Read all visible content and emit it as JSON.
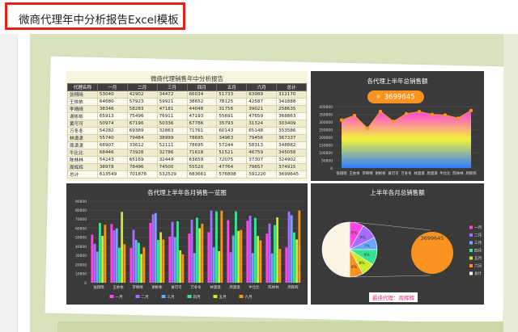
{
  "page": {
    "title": "微商代理年中分析报告Excel模板"
  },
  "table": {
    "title": "微商代理销售年中分析报告",
    "columns": [
      "代理名称",
      "一月",
      "二月",
      "三月",
      "四月",
      "五月",
      "六月",
      "总计"
    ],
    "rows": [
      [
        "张翔晓",
        "53040",
        "42902",
        "34472",
        "66034",
        "51733",
        "63989",
        "312170"
      ],
      [
        "王依依",
        "64680",
        "57923",
        "59921",
        "38652",
        "78125",
        "42587",
        "341888"
      ],
      [
        "李晴晴",
        "38346",
        "58283",
        "47181",
        "44048",
        "31756",
        "39021",
        "258635"
      ],
      [
        "谢彬彬",
        "65913",
        "75496",
        "76911",
        "47193",
        "55691",
        "47659",
        "368863"
      ],
      [
        "黄可可",
        "50974",
        "67196",
        "50336",
        "67786",
        "35793",
        "31324",
        "303409"
      ],
      [
        "万冬冬",
        "54282",
        "69389",
        "32863",
        "71761",
        "60143",
        "65148",
        "353586"
      ],
      [
        "林潇潇",
        "55740",
        "79484",
        "38999",
        "78695",
        "34963",
        "79456",
        "367337"
      ],
      [
        "周潇潇",
        "68907",
        "33612",
        "52111",
        "78695",
        "57244",
        "58313",
        "348882"
      ],
      [
        "牛比比",
        "68446",
        "73928",
        "32786",
        "71618",
        "51521",
        "46759",
        "345058"
      ],
      [
        "陈林林",
        "54243",
        "65169",
        "32449",
        "63659",
        "72075",
        "37307",
        "324902"
      ],
      [
        "周辉辉",
        "38978",
        "78496",
        "74500",
        "55520",
        "47764",
        "79657",
        "374915"
      ],
      [
        "总计",
        "613549",
        "701878",
        "532529",
        "683661",
        "576808",
        "591220",
        "3699645"
      ]
    ]
  },
  "area_chart": {
    "title": "各代理上半年总销售额",
    "total_label": "3699645",
    "icon": "money-icon"
  },
  "bar_chart": {
    "title": "各代理上半年各月销售一览图"
  },
  "pie_chart": {
    "title": "上半年各月总销售额",
    "total_label": "3699645",
    "best_agent_label": "最佳代理：周辉辉"
  },
  "chart_data": [
    {
      "type": "area",
      "categories": [
        "张翔晓",
        "王依依",
        "李晴晴",
        "谢彬彬",
        "黄可可",
        "万冬冬",
        "林潇潇",
        "周潇潇",
        "牛比比",
        "陈林林",
        "周辉辉"
      ],
      "values": [
        312170,
        341888,
        258635,
        368863,
        303409,
        353586,
        367337,
        348882,
        345058,
        324902,
        374915
      ],
      "ylim": [
        0,
        400000
      ],
      "yticks": [
        0,
        50000,
        100000,
        150000,
        200000,
        250000,
        300000,
        350000,
        400000
      ],
      "colors": {
        "top": "#ff3ce6",
        "middle": "#f2f23c",
        "bottom": "#2f7bff",
        "line": "#f7931e"
      }
    },
    {
      "type": "bar",
      "categories": [
        "张翔晓",
        "王依依",
        "李晴晴",
        "谢彬彬",
        "黄可可",
        "万冬冬",
        "林潇潇",
        "周潇潇",
        "牛比比",
        "陈林林",
        "周辉辉"
      ],
      "ylim": [
        0,
        90000
      ],
      "yticks": [
        0,
        10000,
        20000,
        30000,
        40000,
        50000,
        60000,
        70000,
        80000,
        90000
      ],
      "series": [
        {
          "name": "一月",
          "color": "#ff47e5",
          "values": [
            53040,
            64680,
            38346,
            65913,
            50974,
            54282,
            55740,
            68907,
            68446,
            54243,
            38978
          ]
        },
        {
          "name": "二月",
          "color": "#a76cff",
          "values": [
            42902,
            57923,
            58283,
            75496,
            67196,
            69389,
            79484,
            33612,
            73928,
            65169,
            78496
          ]
        },
        {
          "name": "三月",
          "color": "#6aa8ff",
          "values": [
            34472,
            59921,
            47181,
            76911,
            50336,
            32863,
            38999,
            52111,
            32786,
            32449,
            74500
          ]
        },
        {
          "name": "四月",
          "color": "#39e28f",
          "values": [
            66034,
            38652,
            44048,
            47193,
            67786,
            71761,
            78695,
            78695,
            71618,
            63659,
            55520
          ]
        },
        {
          "name": "五月",
          "color": "#c8ee2b",
          "values": [
            51733,
            78125,
            31756,
            55691,
            35793,
            60143,
            34963,
            57244,
            51521,
            72075,
            47764
          ]
        },
        {
          "name": "六月",
          "color": "#f7931e",
          "values": [
            63989,
            42587,
            39021,
            47659,
            31324,
            65148,
            79456,
            58313,
            46759,
            37307,
            79657
          ]
        }
      ]
    },
    {
      "type": "pie",
      "categories": [
        "一月",
        "二月",
        "三月",
        "四月",
        "五月",
        "六月",
        "总计"
      ],
      "values": [
        613549,
        701878,
        532529,
        683661,
        576808,
        591220,
        3699645
      ],
      "slice_labels": [
        "8%",
        "9%",
        "7%",
        "9%",
        "8%",
        "8%",
        ""
      ],
      "colors": [
        "#ff47e5",
        "#a76cff",
        "#6aa8ff",
        "#39e28f",
        "#c8ee2b",
        "#f7931e",
        "#fbf6e4"
      ],
      "highlight_color": "#f7931e"
    }
  ]
}
